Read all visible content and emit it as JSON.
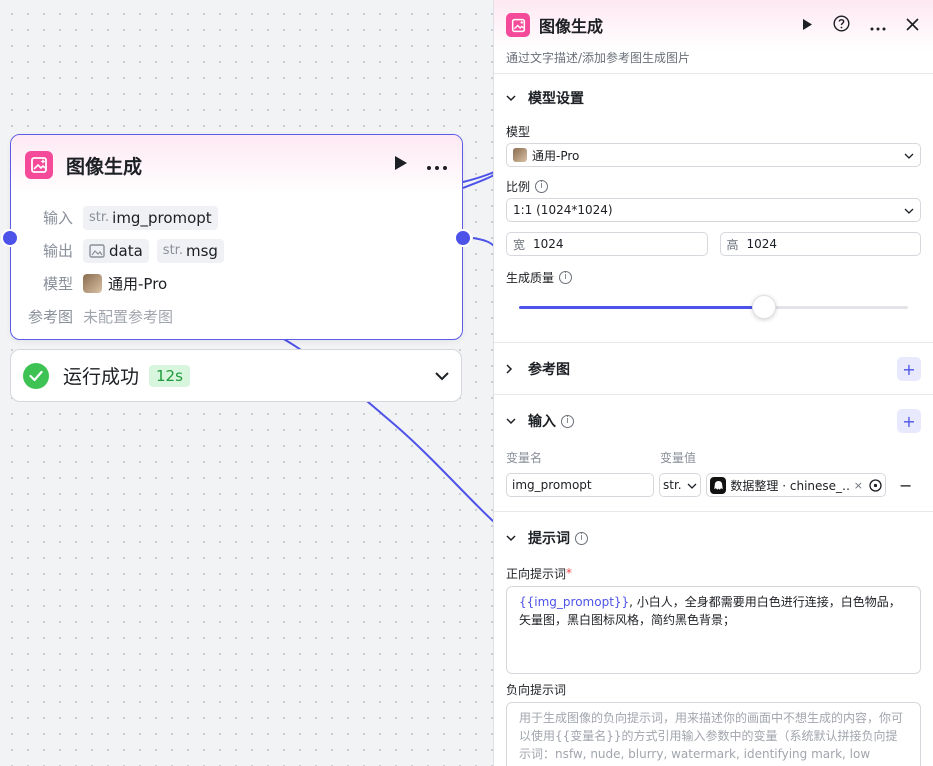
{
  "node": {
    "title": "图像生成",
    "input_label": "输入",
    "input_type": "str.",
    "input_var": "img_promopt",
    "output_label": "输出",
    "output_data": "data",
    "output_type": "str.",
    "output_msg": "msg",
    "model_label": "模型",
    "model_value": "通用-Pro",
    "ref_label": "参考图",
    "ref_value": "未配置参考图"
  },
  "status": {
    "text": "运行成功",
    "duration": "12s"
  },
  "panel": {
    "title": "图像生成",
    "description": "通过文字描述/添加参考图生成图片",
    "model_section": {
      "title": "模型设置",
      "model_label": "模型",
      "model_value": "通用-Pro",
      "ratio_label": "比例",
      "ratio_value": "1:1 (1024*1024)",
      "width_prefix": "宽",
      "width_value": "1024",
      "height_prefix": "高",
      "height_value": "1024",
      "quality_label": "生成质量",
      "quality_fraction": 0.63
    },
    "reference_section": {
      "title": "参考图"
    },
    "input_section": {
      "title": "输入",
      "col_name": "变量名",
      "col_value": "变量值",
      "var_name": "img_promopt",
      "var_type": "str.",
      "var_ref": "数据整理 · chinese_…",
      "remove": "−"
    },
    "prompt_section": {
      "title": "提示词",
      "positive_label": "正向提示词",
      "positive_required": "*",
      "positive_var": "{{img_promopt}}",
      "positive_text": ", 小白人，全身都需要用白色进行连接，白色物品，矢量图，黑白图标风格，简约黑色背景；",
      "negative_label": "负向提示词",
      "negative_placeholder": "用于生成图像的负向提示词，用来描述你的画面中不想生成的内容，你可以使用{{变量名}}的方式引用输入参数中的变量（系统默认拼接负向提示词：nsfw, nude, blurry, watermark, identifying mark, low resolution, mutated, lack of hierarchy）"
    }
  },
  "colors": {
    "accent": "#4d53e8",
    "brand_pink": "#f54a9a",
    "success": "#3ec254"
  }
}
